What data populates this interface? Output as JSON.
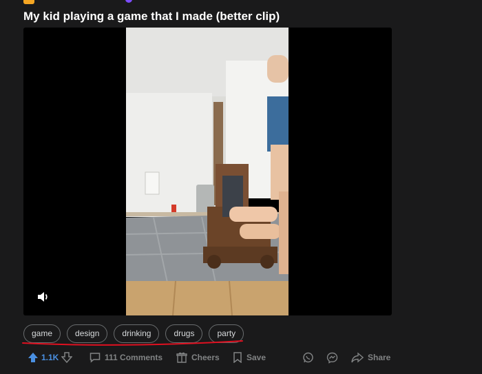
{
  "post": {
    "title": "My kid playing a game that I made (better clip)"
  },
  "tags": [
    "game",
    "design",
    "drinking",
    "drugs",
    "party"
  ],
  "actions": {
    "votes": "1.1K",
    "comments": "111 Comments",
    "cheers": "Cheers",
    "save": "Save",
    "share": "Share"
  },
  "colors": {
    "background": "#1a1a1b",
    "upvote_active": "#4a90e2",
    "annotation_underline": "#e01020"
  },
  "icons": [
    "subreddit-icon",
    "upvote-icon",
    "downvote-icon",
    "comment-icon",
    "cheers-icon",
    "save-icon",
    "whatsapp-icon",
    "messenger-icon",
    "share-icon",
    "volume-icon"
  ]
}
